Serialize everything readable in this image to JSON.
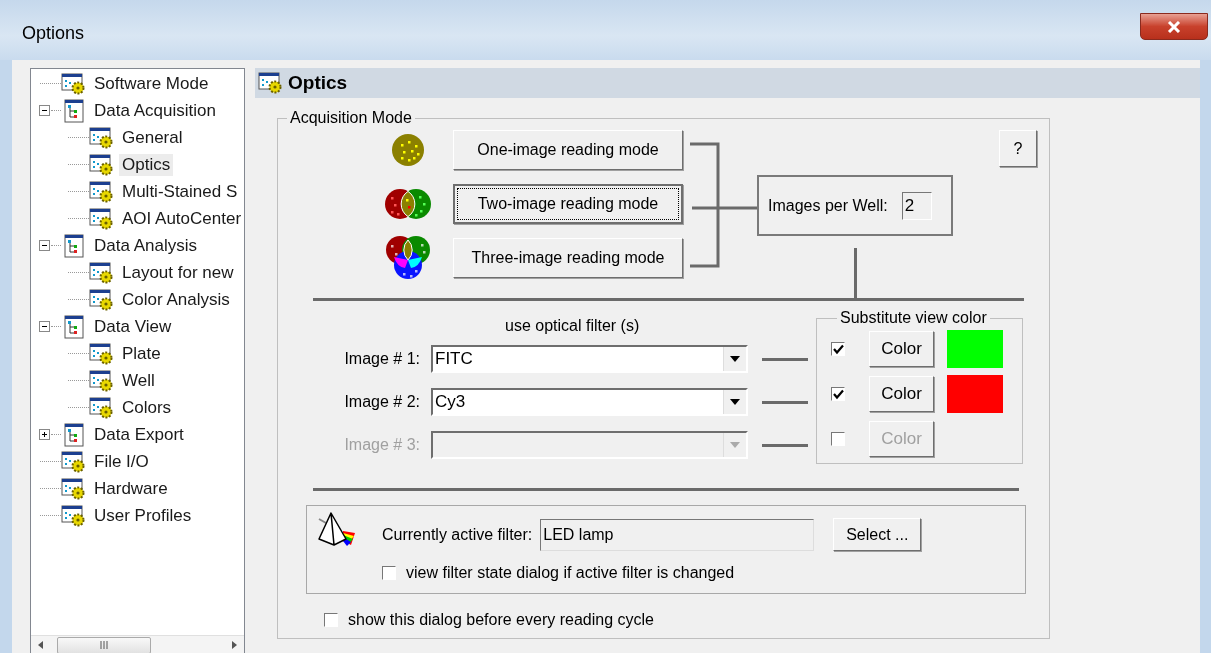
{
  "window": {
    "title": "Options"
  },
  "tree": [
    {
      "label": "Software Mode",
      "selected": false
    },
    {
      "label": "Data Acquisition",
      "selected": false,
      "expanded": true,
      "children": [
        {
          "label": "General",
          "selected": false
        },
        {
          "label": "Optics",
          "selected": true
        },
        {
          "label": "Multi-Stained S",
          "selected": false
        },
        {
          "label": "AOI AutoCenter",
          "selected": false
        }
      ]
    },
    {
      "label": "Data Analysis",
      "selected": false,
      "expanded": true,
      "children": [
        {
          "label": "Layout for new",
          "selected": false
        },
        {
          "label": "Color Analysis",
          "selected": false
        }
      ]
    },
    {
      "label": "Data View",
      "selected": false,
      "expanded": true,
      "children": [
        {
          "label": "Plate",
          "selected": false
        },
        {
          "label": "Well",
          "selected": false
        },
        {
          "label": "Colors",
          "selected": false
        }
      ]
    },
    {
      "label": "Data Export",
      "selected": false,
      "expanded": false
    },
    {
      "label": "File I/O",
      "selected": false
    },
    {
      "label": "Hardware",
      "selected": false
    },
    {
      "label": "User Profiles",
      "selected": false
    }
  ],
  "panel": {
    "title": "Optics"
  },
  "acquisition_mode": {
    "legend": "Acquisition Mode",
    "help_button": "?",
    "modes": [
      {
        "kind": "single",
        "label": "One-image reading mode",
        "selected": false
      },
      {
        "kind": "double",
        "label": "Two-image reading mode",
        "selected": true
      },
      {
        "kind": "triple",
        "label": "Three-image reading mode",
        "selected": false
      }
    ],
    "images_per_well": {
      "label": "Images per Well:",
      "value": "2"
    }
  },
  "filters": {
    "caption": "use optical filter (s)",
    "substitute_legend": "Substitute view color",
    "rows": [
      {
        "label": "Image # 1:",
        "value": "FITC",
        "disabled": false,
        "substitute": {
          "checked": true,
          "button": "Color",
          "disabled": false,
          "color": "#00ff00"
        }
      },
      {
        "label": "Image # 2:",
        "value": "Cy3",
        "disabled": false,
        "substitute": {
          "checked": true,
          "button": "Color",
          "disabled": false,
          "color": "#ff0000"
        }
      },
      {
        "label": "Image # 3:",
        "disabled": true,
        "substitute": {
          "checked": false,
          "button": "Color",
          "disabled": true
        }
      }
    ]
  },
  "active_filter": {
    "label": "Currently active filter:",
    "value": "LED lamp",
    "select_button": "Select ...",
    "view_dialog": {
      "label": "view filter state dialog if active filter is changed",
      "checked": false
    }
  },
  "show_dialog": {
    "label": "show this dialog before every reading cycle",
    "checked": false
  }
}
